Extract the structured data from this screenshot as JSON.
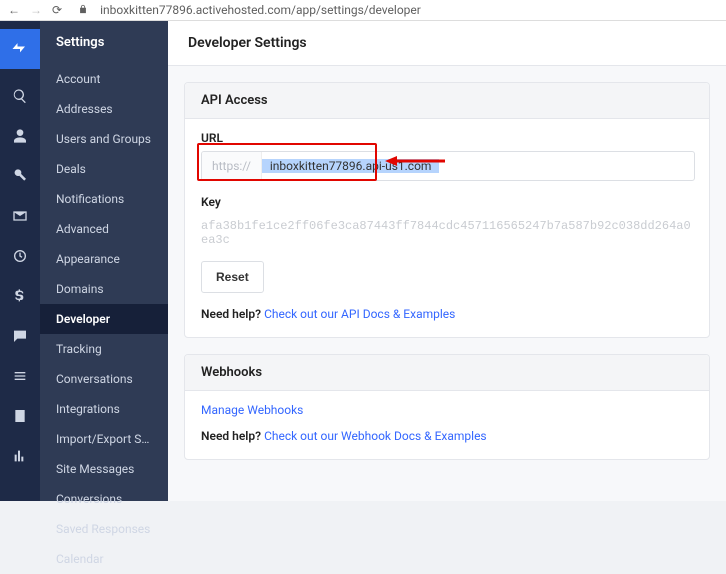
{
  "browser": {
    "url": "inboxkitten77896.activehosted.com/app/settings/developer"
  },
  "sidebar": {
    "title": "Settings",
    "items": [
      "Account",
      "Addresses",
      "Users and Groups",
      "Deals",
      "Notifications",
      "Advanced",
      "Appearance",
      "Domains",
      "Developer",
      "Tracking",
      "Conversations",
      "Integrations",
      "Import/Export Status",
      "Site Messages",
      "Conversions",
      "Saved Responses",
      "Calendar"
    ],
    "activeIndex": 8
  },
  "main": {
    "title": "Developer Settings"
  },
  "api": {
    "section_title": "API Access",
    "url_label": "URL",
    "url_prefix": "https://",
    "url_value": "inboxkitten77896.api-us1.com",
    "key_label": "Key",
    "key_value": "afa38b1fe1ce2ff06fe3ca87443ff7844cdc457116565247b7a587b92c038dd264a0ea3c",
    "reset_label": "Reset",
    "help_prefix": "Need help?",
    "help_link": "Check out our API Docs & Examples"
  },
  "webhooks": {
    "section_title": "Webhooks",
    "manage_link": "Manage Webhooks",
    "help_prefix": "Need help?",
    "help_link": "Check out our Webhook Docs & Examples"
  }
}
